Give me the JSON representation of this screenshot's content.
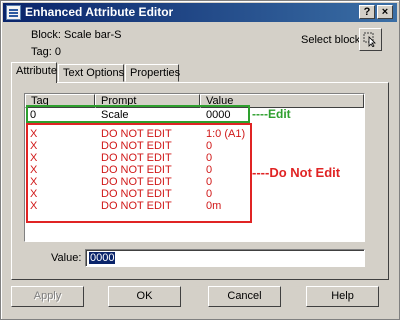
{
  "window": {
    "title": "Enhanced Attribute Editor",
    "help_label": "?",
    "close_label": "×"
  },
  "block_info": {
    "block_line": "Block: Scale bar-S",
    "tag_line": "Tag: 0"
  },
  "select_block": {
    "label": "Select block"
  },
  "tabs": [
    {
      "label": "Attribute",
      "active": true
    },
    {
      "label": "Text Options",
      "active": false
    },
    {
      "label": "Properties",
      "active": false
    }
  ],
  "table": {
    "headers": {
      "tag": "Tag",
      "prompt": "Prompt",
      "value": "Value"
    },
    "rows": [
      {
        "tag": "0",
        "prompt": "Scale",
        "value": "0000"
      },
      {
        "tag": "X",
        "prompt": "DO NOT EDIT",
        "value": "1:0 (A1)"
      },
      {
        "tag": "X",
        "prompt": "DO NOT EDIT",
        "value": "0"
      },
      {
        "tag": "X",
        "prompt": "DO NOT EDIT",
        "value": "0"
      },
      {
        "tag": "X",
        "prompt": "DO NOT EDIT",
        "value": "0"
      },
      {
        "tag": "X",
        "prompt": "DO NOT EDIT",
        "value": "0"
      },
      {
        "tag": "X",
        "prompt": "DO NOT EDIT",
        "value": "0"
      },
      {
        "tag": "X",
        "prompt": "DO NOT EDIT",
        "value": "0m"
      }
    ]
  },
  "annotations": {
    "edit": "----Edit",
    "do_not_edit": "----Do Not Edit"
  },
  "value_field": {
    "label": "Value:",
    "value": "0000"
  },
  "buttons": {
    "apply": "Apply",
    "ok": "OK",
    "cancel": "Cancel",
    "help": "Help"
  },
  "colors": {
    "edit_highlight": "#2ea02e",
    "do_not_edit_highlight": "#e02424",
    "title_bar": "#0a246a"
  }
}
